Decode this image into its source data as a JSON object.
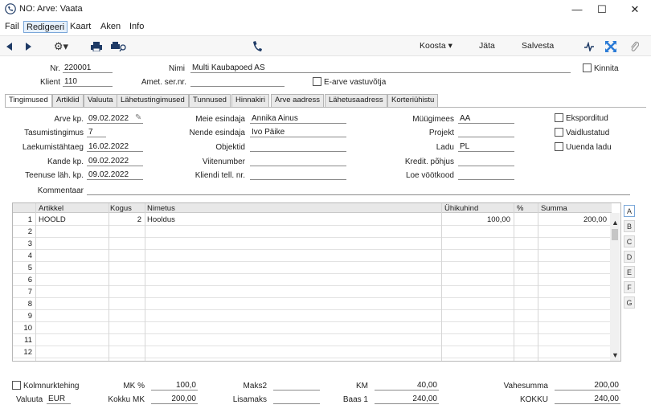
{
  "window": {
    "title": "NO: Arve: Vaata",
    "controls": {
      "minimize": "—",
      "maximize": "☐",
      "close": "✕"
    }
  },
  "menu": [
    "Fail",
    "Redigeeri",
    "Kaart",
    "Aken",
    "Info"
  ],
  "toolbar": {
    "koosta": "Koosta",
    "jata": "Jäta",
    "salvesta": "Salvesta"
  },
  "header": {
    "nr_label": "Nr.",
    "nr_value": "220001",
    "nimi_label": "Nimi",
    "nimi_value": "Multi Kaubapoed AS",
    "kinnita_label": "Kinnita",
    "klient_label": "Klient",
    "klient_value": "110",
    "amet_label": "Amet. ser.nr.",
    "amet_value": "",
    "earve_label": "E-arve vastuvõtja"
  },
  "tabs": [
    "Tingimused",
    "Artiklid",
    "Valuuta",
    "Lähetustingimused",
    "Tunnused",
    "Hinnakiri",
    "Arve aadress",
    "Lähetusaadress",
    "Korteriühistu"
  ],
  "tingimused": {
    "arve_kp_label": "Arve kp.",
    "arve_kp": "09.02.2022",
    "tasumis_label": "Tasumistingimus",
    "tasumis": "7",
    "laekumis_label": "Laekumistähtaeg",
    "laekumis": "16.02.2022",
    "kande_label": "Kande kp.",
    "kande": "09.02.2022",
    "teenuse_label": "Teenuse läh. kp.",
    "teenuse": "09.02.2022",
    "kommentaar_label": "Kommentaar",
    "kommentaar": "",
    "meie_label": "Meie esindaja",
    "meie": "Annika Ainus",
    "nende_label": "Nende esindaja",
    "nende": "Ivo Päike",
    "objektid_label": "Objektid",
    "objektid": "",
    "viite_label": "Viitenumber",
    "viite": "",
    "kliendi_tel_label": "Kliendi tell. nr.",
    "kliendi_tel": "",
    "myygimees_label": "Müügimees",
    "myygimees": "AA",
    "projekt_label": "Projekt",
    "projekt": "",
    "ladu_label": "Ladu",
    "ladu": "PL",
    "kredit_label": "Kredit. põhjus",
    "kredit": "",
    "loe_label": "Loe vöötkood",
    "loe": "",
    "eksporditud": "Eksporditud",
    "vaidlustatud": "Vaidlustatud",
    "uuenda": "Uuenda ladu"
  },
  "grid": {
    "columns": {
      "artikkel": "Artikkel",
      "kogus": "Kogus",
      "nimetus": "Nimetus",
      "yhikuhind": "Ühikuhind",
      "protsent": "%",
      "summa": "Summa"
    },
    "rows": [
      {
        "n": "1",
        "artikkel": "HOOLD",
        "kogus": "2",
        "nimetus": "Hooldus",
        "yhikuhind": "100,00",
        "protsent": "",
        "summa": "200,00"
      },
      {
        "n": "2",
        "artikkel": "",
        "kogus": "",
        "nimetus": "",
        "yhikuhind": "",
        "protsent": "",
        "summa": ""
      },
      {
        "n": "3",
        "artikkel": "",
        "kogus": "",
        "nimetus": "",
        "yhikuhind": "",
        "protsent": "",
        "summa": ""
      },
      {
        "n": "4",
        "artikkel": "",
        "kogus": "",
        "nimetus": "",
        "yhikuhind": "",
        "protsent": "",
        "summa": ""
      },
      {
        "n": "5",
        "artikkel": "",
        "kogus": "",
        "nimetus": "",
        "yhikuhind": "",
        "protsent": "",
        "summa": ""
      },
      {
        "n": "6",
        "artikkel": "",
        "kogus": "",
        "nimetus": "",
        "yhikuhind": "",
        "protsent": "",
        "summa": ""
      },
      {
        "n": "7",
        "artikkel": "",
        "kogus": "",
        "nimetus": "",
        "yhikuhind": "",
        "protsent": "",
        "summa": ""
      },
      {
        "n": "8",
        "artikkel": "",
        "kogus": "",
        "nimetus": "",
        "yhikuhind": "",
        "protsent": "",
        "summa": ""
      },
      {
        "n": "9",
        "artikkel": "",
        "kogus": "",
        "nimetus": "",
        "yhikuhind": "",
        "protsent": "",
        "summa": ""
      },
      {
        "n": "10",
        "artikkel": "",
        "kogus": "",
        "nimetus": "",
        "yhikuhind": "",
        "protsent": "",
        "summa": ""
      },
      {
        "n": "11",
        "artikkel": "",
        "kogus": "",
        "nimetus": "",
        "yhikuhind": "",
        "protsent": "",
        "summa": ""
      },
      {
        "n": "12",
        "artikkel": "",
        "kogus": "",
        "nimetus": "",
        "yhikuhind": "",
        "protsent": "",
        "summa": ""
      }
    ],
    "side_letters": [
      "A",
      "B",
      "C",
      "D",
      "E",
      "F",
      "G"
    ]
  },
  "footer": {
    "kolmnurk_label": "Kolmnurktehing",
    "valuuta_label": "Valuuta",
    "valuuta": "EUR",
    "mk_label": "MK %",
    "mk": "100,0",
    "kokku_mk_label": "Kokku MK",
    "kokku_mk": "200,00",
    "maks2_label": "Maks2",
    "maks2": "",
    "lisamaks_label": "Lisamaks",
    "lisamaks": "",
    "km_label": "KM",
    "km": "40,00",
    "baas1_label": "Baas 1",
    "baas1": "240,00",
    "vahesumma_label": "Vahesumma",
    "vahesumma": "200,00",
    "kokku_label": "KOKKU",
    "kokku": "240,00"
  }
}
